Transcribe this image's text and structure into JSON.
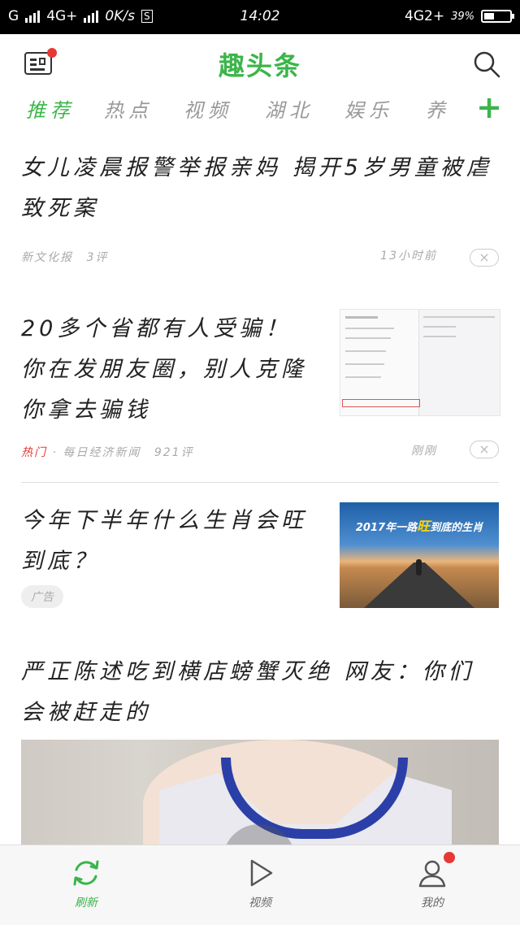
{
  "status_bar": {
    "carrier_left": "G",
    "network1": "4G+",
    "speed": "0K/s",
    "s_badge": "S",
    "time": "14:02",
    "network_right": "4G2+",
    "battery_text": "39%",
    "battery_level": 0.39
  },
  "header": {
    "title": "趣头条",
    "news_icon": "newspaper-icon",
    "search_icon": "search-icon"
  },
  "tabs": [
    {
      "label": "推荐",
      "active": true
    },
    {
      "label": "热点",
      "active": false
    },
    {
      "label": "视频",
      "active": false
    },
    {
      "label": "湖北",
      "active": false
    },
    {
      "label": "娱乐",
      "active": false
    },
    {
      "label": "养",
      "active": false
    }
  ],
  "add_tab_label": "+",
  "articles": [
    {
      "headline": "女儿凌晨报警举报亲妈 揭开5岁男童被虐致死案",
      "source": "新文化报",
      "comments": "3评",
      "time": "13小时前",
      "close": "×"
    },
    {
      "headline": "20多个省都有人受骗！你在发朋友圈，别人克隆你拿去骗钱",
      "hot": "热门",
      "source": "· 每日经济新闻",
      "comments": "921评",
      "time": "刚刚",
      "close": "×"
    },
    {
      "headline": "今年下半年什么生肖会旺到底？",
      "ad": "广告",
      "image_caption_a": "2017年一路",
      "image_caption_b": "旺",
      "image_caption_c": "到底的生肖"
    },
    {
      "headline": "严正陈述吃到横店螃蟹灭绝 网友：你们会被赶走的"
    }
  ],
  "tab_bar": [
    {
      "label": "刷新",
      "icon": "refresh-icon",
      "active": true
    },
    {
      "label": "视频",
      "icon": "play-icon",
      "active": false
    },
    {
      "label": "我的",
      "icon": "user-icon",
      "active": false
    }
  ],
  "colors": {
    "accent": "#3bb54a",
    "hot": "#e53935",
    "badge": "#e53935"
  }
}
